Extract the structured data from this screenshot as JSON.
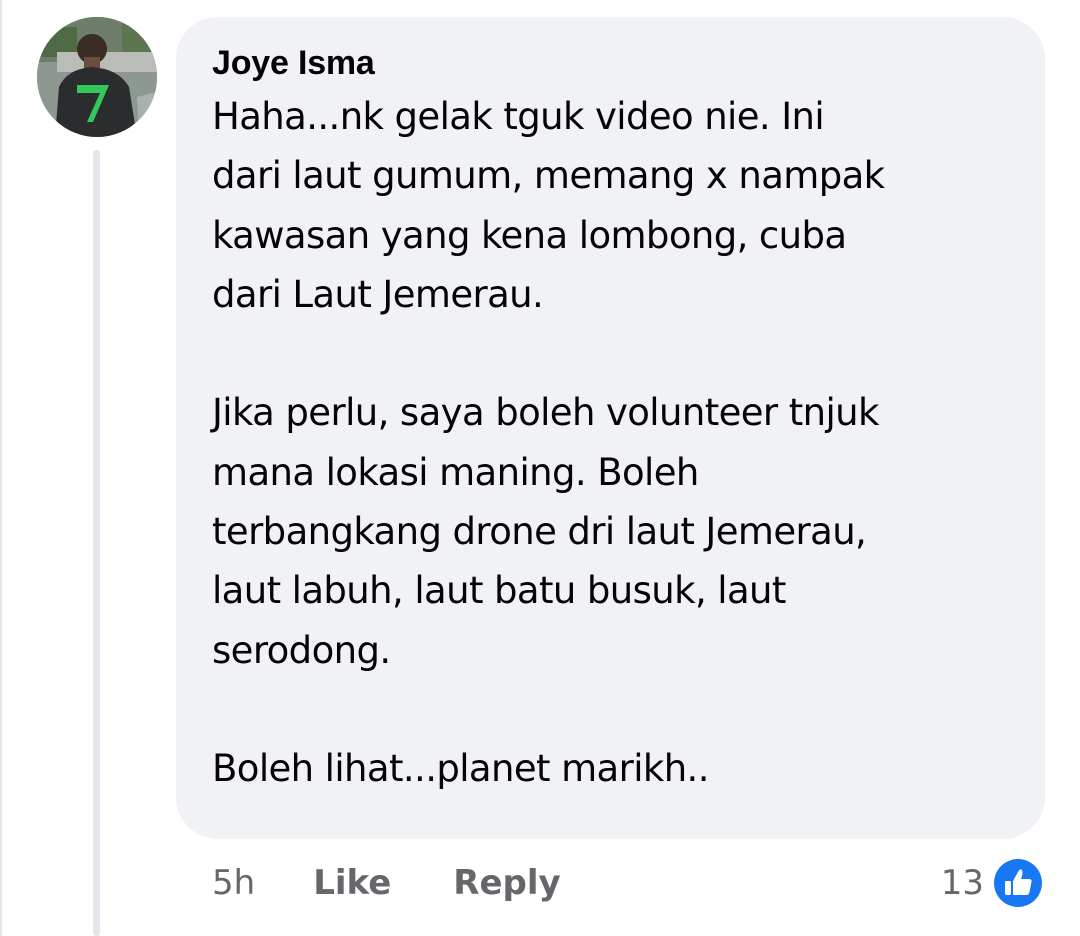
{
  "comment": {
    "author": "Joye Isma",
    "text": "Haha...nk gelak tguk video nie. Ini\ndari laut gumum, memang x nampak\nkawasan yang kena lombong, cuba\ndari Laut Jemerau.\n\nJika perlu, saya boleh volunteer tnjuk\nmana lokasi maning. Boleh\nterbangkang drone dri laut Jemerau,\nlaut labuh, laut batu busuk, laut\nserodong.\n\nBoleh lihat...planet marikh..",
    "avatar_icon": "profile-photo"
  },
  "actions": {
    "time": "5h",
    "like_label": "Like",
    "reply_label": "Reply"
  },
  "reactions": {
    "count": "13",
    "icon": "thumbs-up-icon",
    "color": "#1877f2"
  }
}
